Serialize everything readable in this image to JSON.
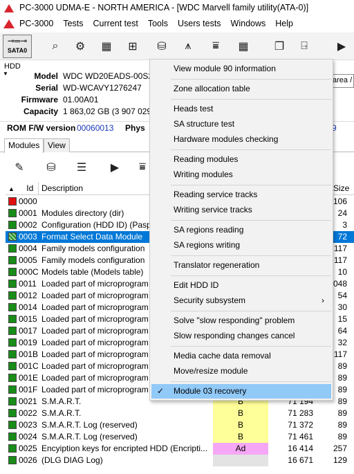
{
  "window": {
    "title": "PC-3000 UDMA-E - NORTH AMERICA - [WDC Marvell family utility(ATA-0)]"
  },
  "menubar": {
    "items": [
      "PC-3000",
      "Tests",
      "Current test",
      "Tools",
      "Users tests",
      "Windows",
      "Help"
    ]
  },
  "toolbar": {
    "sata_label": "SATA0"
  },
  "hdd": {
    "panel_label": "HDD",
    "model_key": "Model",
    "model": "WDC WD20EADS-00S2E",
    "serial_key": "Serial",
    "serial": "WD-WCAVY1276247",
    "firmware_key": "Firmware",
    "firmware": "01.00A01",
    "capacity_key": "Capacity",
    "capacity": "1 863,02 GB (3 907 029 1"
  },
  "area_box": "area / ",
  "rom": {
    "key": "ROM F/W version",
    "value": "00060013",
    "phys": "Phys",
    "right_value": "9"
  },
  "tabs": [
    "Modules",
    "View"
  ],
  "table": {
    "headers": {
      "id": "Id",
      "description": "Description",
      "size": "Size"
    },
    "rows": [
      {
        "id": "0000",
        "desc": "",
        "type": "",
        "len": "",
        "size": "106",
        "status": "red"
      },
      {
        "id": "0001",
        "desc": "Modules directory (dir)",
        "type": "",
        "len": "",
        "size": "24",
        "status": "green"
      },
      {
        "id": "0002",
        "desc": "Configuration (HDD ID) (Pasp",
        "type": "",
        "len": "",
        "size": "3",
        "status": "green"
      },
      {
        "id": "0003",
        "desc": "Format Select Data Module",
        "type": "",
        "len": "",
        "size": "72",
        "status": "hatch"
      },
      {
        "id": "0004",
        "desc": "Family models configuration",
        "type": "",
        "len": "",
        "size": "117",
        "status": "green"
      },
      {
        "id": "0005",
        "desc": "Family models configuration",
        "type": "",
        "len": "",
        "size": "117",
        "status": "green"
      },
      {
        "id": "000C",
        "desc": "Models table (Models table)",
        "type": "",
        "len": "",
        "size": "10",
        "status": "green"
      },
      {
        "id": "0011",
        "desc": "Loaded part of microprogram",
        "type": "",
        "len": "",
        "size": "048",
        "status": "green"
      },
      {
        "id": "0012",
        "desc": "Loaded part of microprogram",
        "type": "",
        "len": "",
        "size": "54",
        "status": "green"
      },
      {
        "id": "0014",
        "desc": "Loaded part of microprogram",
        "type": "",
        "len": "",
        "size": "30",
        "status": "green"
      },
      {
        "id": "0015",
        "desc": "Loaded part of microprogram",
        "type": "",
        "len": "",
        "size": "15",
        "status": "green"
      },
      {
        "id": "0017",
        "desc": "Loaded part of microprogram",
        "type": "",
        "len": "",
        "size": "64",
        "status": "green"
      },
      {
        "id": "0019",
        "desc": "Loaded part of microprogram",
        "type": "",
        "len": "",
        "size": "32",
        "status": "green"
      },
      {
        "id": "001B",
        "desc": "Loaded part of microprogram",
        "type": "",
        "len": "",
        "size": "117",
        "status": "green"
      },
      {
        "id": "001C",
        "desc": "Loaded part of microprogram",
        "type": "",
        "len": "",
        "size": "89",
        "status": "green"
      },
      {
        "id": "001E",
        "desc": "Loaded part of microprogram",
        "type": "",
        "len": "",
        "size": "89",
        "status": "green"
      },
      {
        "id": "001F",
        "desc": "Loaded part of microprogram",
        "type": "",
        "len": "",
        "size": "89",
        "status": "green"
      },
      {
        "id": "0021",
        "desc": "S.M.A.R.T.",
        "type": "B",
        "len": "71 194",
        "size": "89",
        "status": "green",
        "type_color": "#ffff99"
      },
      {
        "id": "0022",
        "desc": "S.M.A.R.T.",
        "type": "B",
        "len": "71 283",
        "size": "89",
        "status": "green",
        "type_color": "#ffff99"
      },
      {
        "id": "0023",
        "desc": "S.M.A.R.T. Log (reserved)",
        "type": "B",
        "len": "71 372",
        "size": "89",
        "status": "green",
        "type_color": "#ffff99"
      },
      {
        "id": "0024",
        "desc": "S.M.A.R.T. Log (reserved)",
        "type": "B",
        "len": "71 461",
        "size": "89",
        "status": "green",
        "type_color": "#ffff99"
      },
      {
        "id": "0025",
        "desc": "Encyiption keys for encripted HDD (Encripti...",
        "type": "Ad",
        "len": "16 414",
        "size": "257",
        "status": "green",
        "type_color": "#f5a7f5"
      },
      {
        "id": "0026",
        "desc": "(DLG DIAG Log)",
        "type": "",
        "len": "16 671",
        "size": "129",
        "status": "green",
        "type_color": "#e3e3e3"
      }
    ]
  },
  "context_menu": {
    "groups": [
      [
        "View module 90 information"
      ],
      [
        "Zone allocation table"
      ],
      [
        "Heads test",
        "SA structure test",
        "Hardware modules checking"
      ],
      [
        "Reading modules",
        "Writing modules"
      ],
      [
        "Reading service tracks",
        "Writing service tracks"
      ],
      [
        "SA regions reading",
        "SA regions writing"
      ],
      [
        "Translator regeneration"
      ],
      [
        "Edit HDD ID",
        "Security subsystem"
      ],
      [
        "Solve \"slow responding\" problem",
        "Slow responding changes cancel"
      ],
      [
        "Media cache data removal",
        "Move/resize module"
      ],
      [
        "Module 03 recovery"
      ]
    ],
    "submenu_item": "Security subsystem",
    "checked_item": "Module 03 recovery",
    "highlighted_item": "Module 03 recovery"
  },
  "colors": {
    "selection": "#0078d7",
    "menu_highlight": "#91c9f7",
    "status_green": "#198c19",
    "status_red": "#e01010",
    "link_blue": "#1a39b8"
  }
}
